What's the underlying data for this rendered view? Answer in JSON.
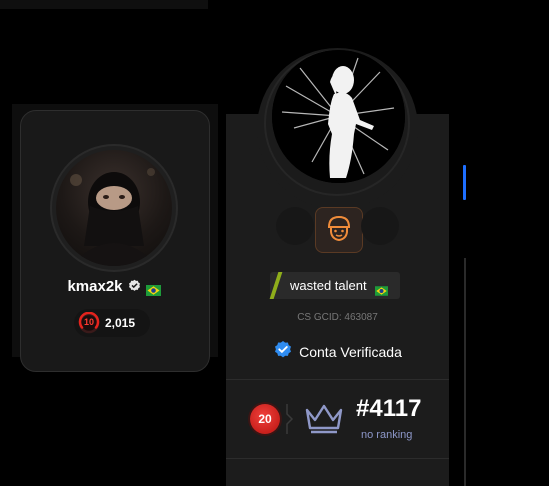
{
  "left_profile": {
    "username": "kmax2k",
    "elo_level": "10",
    "elo_points": "2,015",
    "flag_icon": "brazil-flag-icon",
    "verified_icon": "verified-check-icon"
  },
  "main_profile": {
    "nickname": "wasted talent",
    "gcid_label": "CS GCID: 463087",
    "verified_label": "Conta Verificada",
    "level": "20",
    "rank": "#4117",
    "rank_label": "no ranking",
    "flag_icon": "brazil-flag-icon",
    "crown_icon": "crown-icon",
    "badge_icon": "helmet-face-icon"
  },
  "colors": {
    "background": "#000000",
    "card": "#1c1c1c",
    "accent_blue": "#1e6fff",
    "tag_green": "#8fae1b",
    "level_red": "#d8281f",
    "rank_label": "#8d97c9",
    "badge_orange": "#f08c3a"
  }
}
